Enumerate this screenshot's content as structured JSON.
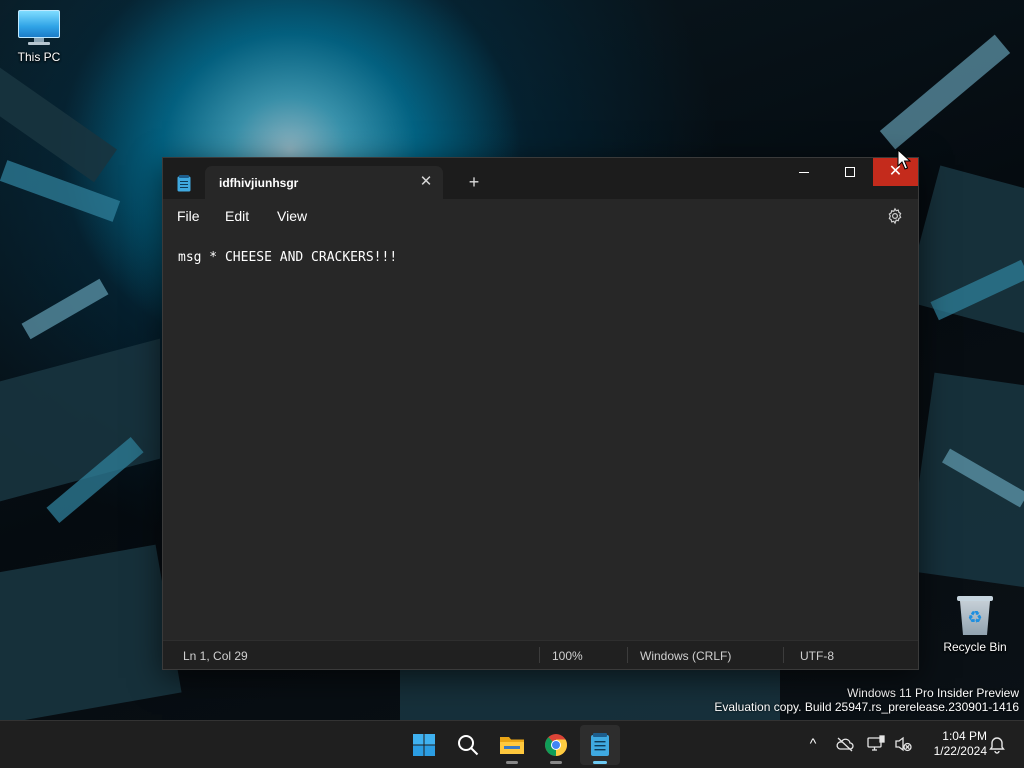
{
  "desktop": {
    "icons": [
      {
        "label": "This PC",
        "icon": "computer-monitor-icon"
      },
      {
        "label": "Recycle Bin",
        "icon": "recycle-bin-icon"
      }
    ],
    "watermark": {
      "line1": "Windows 11 Pro Insider Preview",
      "line2": "Evaluation copy. Build 25947.rs_prerelease.230901-1416"
    }
  },
  "notepad": {
    "tab_title": "idfhivjiunhsgr",
    "tab_close_glyph": "✕",
    "new_tab_glyph": "+",
    "window_buttons": {
      "minimize": "minimize-icon",
      "maximize": "maximize-icon",
      "close": "close-icon",
      "close_glyph": "✕",
      "close_hover_color": "#c42b1c"
    },
    "menu": [
      "File",
      "Edit",
      "View"
    ],
    "settings_icon": "gear-icon",
    "content": "msg * CHEESE AND CRACKERS!!!",
    "status": {
      "position": "Ln 1, Col 29",
      "zoom": "100%",
      "line_endings": "Windows (CRLF)",
      "encoding": "UTF-8"
    }
  },
  "taskbar": {
    "apps": [
      {
        "name": "Start",
        "icon": "windows-start-icon"
      },
      {
        "name": "Search",
        "icon": "search-icon"
      },
      {
        "name": "File Explorer",
        "icon": "folder-icon"
      },
      {
        "name": "Google Chrome",
        "icon": "chrome-icon"
      },
      {
        "name": "Notepad",
        "icon": "notepad-icon",
        "active": true
      }
    ],
    "tray": {
      "chevron_glyph": "^",
      "icons": [
        "onedrive-cloud-icon",
        "network-icon",
        "volume-muted-icon"
      ],
      "time": "1:04 PM",
      "date": "1/22/2024",
      "notification_icon": "bell-icon"
    }
  },
  "colors": {
    "accent": "#6cc9f3",
    "window_bg": "#272727",
    "titlebar_bg": "#1c1c1c",
    "taskbar_bg": "#1f1f1f"
  }
}
